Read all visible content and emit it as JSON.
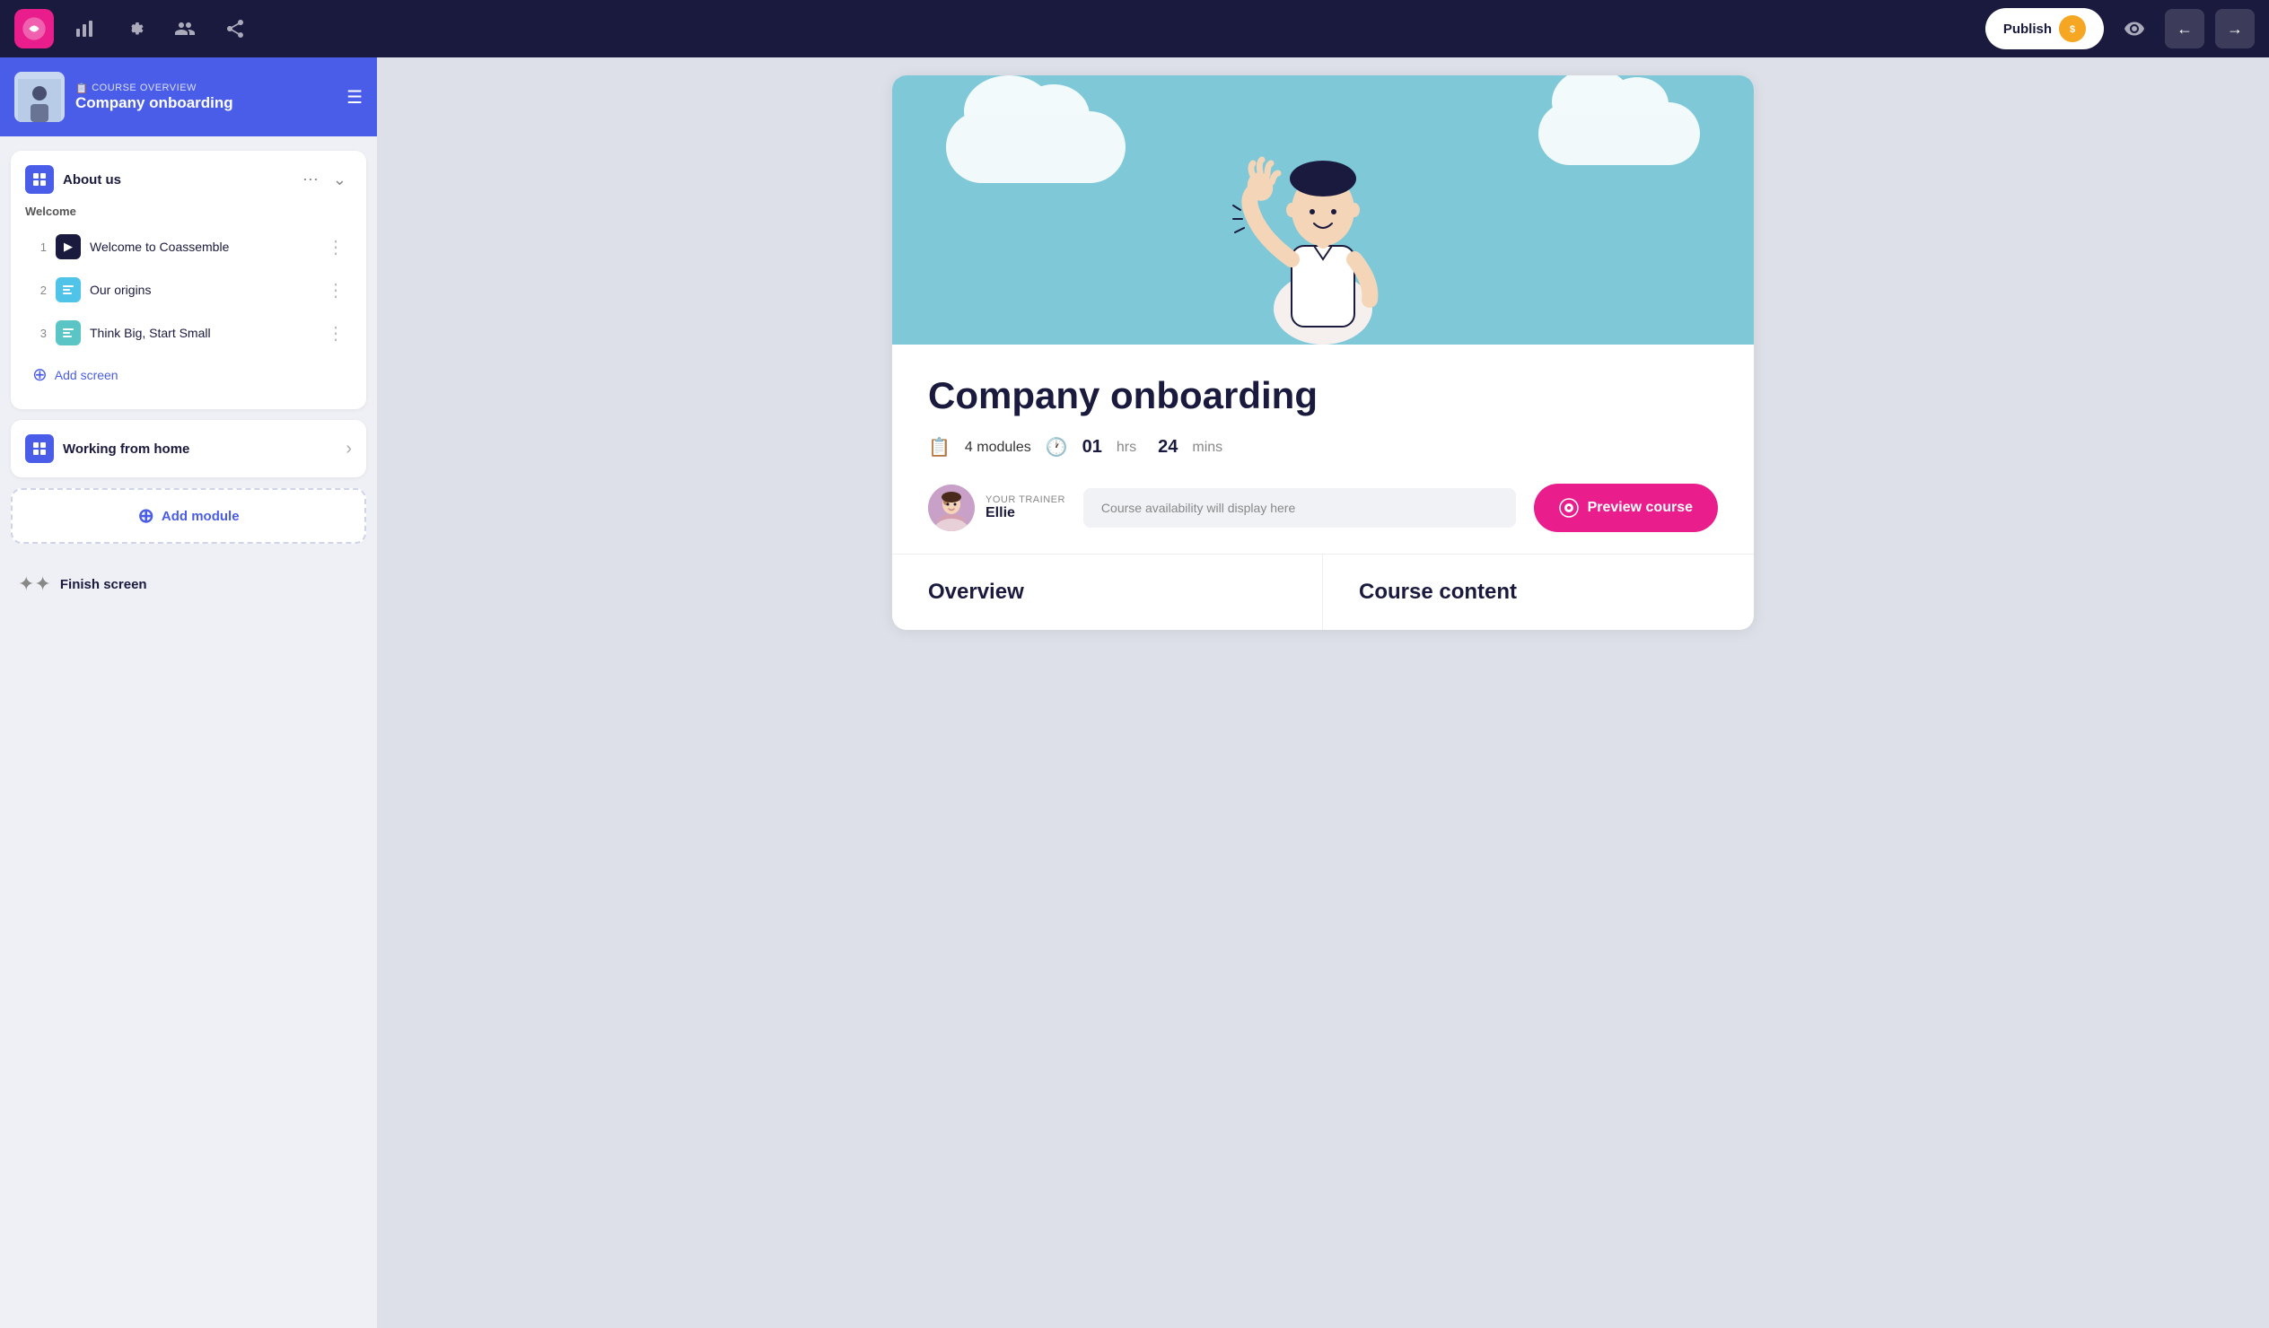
{
  "topnav": {
    "publish_label": "Publish",
    "nav_icons": [
      "bar-chart-icon",
      "gear-icon",
      "people-icon",
      "share-icon"
    ],
    "preview_icon": "eye-icon",
    "back_arrow": "←",
    "forward_arrow": "→"
  },
  "sidebar": {
    "course_overview_label": "COURSE OVERVIEW",
    "course_title": "Company onboarding",
    "modules": [
      {
        "title": "About us",
        "expanded": true,
        "section": "Welcome",
        "screens": [
          {
            "num": "1",
            "name": "Welcome to Coassemble",
            "icon_type": "dark"
          },
          {
            "num": "2",
            "name": "Our origins",
            "icon_type": "blue"
          },
          {
            "num": "3",
            "name": "Think Big, Start Small",
            "icon_type": "teal"
          }
        ],
        "add_screen_label": "Add screen"
      },
      {
        "title": "Working from home",
        "expanded": false
      }
    ],
    "add_module_label": "Add module",
    "finish_screen_label": "Finish screen"
  },
  "course_preview": {
    "title": "Company onboarding",
    "modules_count": "4 modules",
    "duration_hrs": "01",
    "duration_hrs_label": "hrs",
    "duration_mins": "24",
    "duration_mins_label": "mins",
    "trainer_label": "YOUR TRAINER",
    "trainer_name": "Ellie",
    "availability_text": "Course availability will display here",
    "preview_button_label": "Preview course",
    "overview_heading": "Overview",
    "content_heading": "Course content"
  }
}
